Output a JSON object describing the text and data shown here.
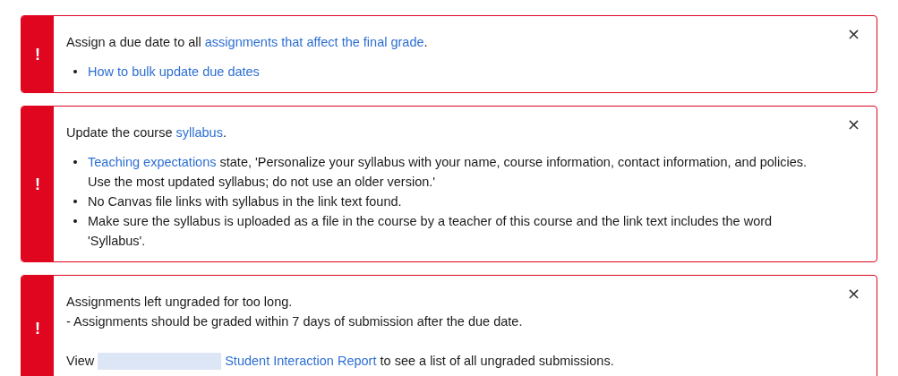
{
  "alerts": [
    {
      "close": "×",
      "blocks": [
        {
          "kind": "paragraph",
          "lines": [
            [
              {
                "kind": "text",
                "text": "Assign a due date to all "
              },
              {
                "kind": "link",
                "text": "assignments that affect the final grade"
              },
              {
                "kind": "text",
                "text": "."
              }
            ]
          ]
        },
        {
          "kind": "bullets",
          "items": [
            [
              {
                "kind": "link",
                "text": "How to bulk update due dates"
              }
            ]
          ]
        }
      ]
    },
    {
      "close": "×",
      "blocks": [
        {
          "kind": "paragraph",
          "lines": [
            [
              {
                "kind": "text",
                "text": "Update the course "
              },
              {
                "kind": "link",
                "text": "syllabus"
              },
              {
                "kind": "text",
                "text": "."
              }
            ]
          ]
        },
        {
          "kind": "bullets",
          "items": [
            [
              {
                "kind": "link",
                "text": "Teaching expectations"
              },
              {
                "kind": "text",
                "text": " state, 'Personalize your syllabus with your name, course information, contact information, and policies. Use the most updated syllabus; do not use an older version.'"
              }
            ],
            [
              {
                "kind": "text",
                "text": "No Canvas file links with syllabus in the link text found."
              }
            ],
            [
              {
                "kind": "text",
                "text": "Make sure the syllabus is uploaded as a file in the course by a teacher of this course and the link text includes the word 'Syllabus'."
              }
            ]
          ]
        }
      ]
    },
    {
      "close": "×",
      "blocks": [
        {
          "kind": "paragraph",
          "lines": [
            [
              {
                "kind": "text",
                "text": "Assignments left ungraded for too long."
              }
            ],
            [
              {
                "kind": "text",
                "text": "- Assignments should be graded within 7 days of submission after the due date."
              }
            ]
          ]
        },
        {
          "kind": "spacer"
        },
        {
          "kind": "paragraph",
          "lines": [
            [
              {
                "kind": "text",
                "text": "View "
              },
              {
                "kind": "redacted"
              },
              {
                "kind": "link",
                "text": "Student Interaction Report"
              },
              {
                "kind": "text",
                "text": " to see a list of all ungraded submissions."
              }
            ]
          ]
        }
      ]
    }
  ],
  "icon_text": "!"
}
